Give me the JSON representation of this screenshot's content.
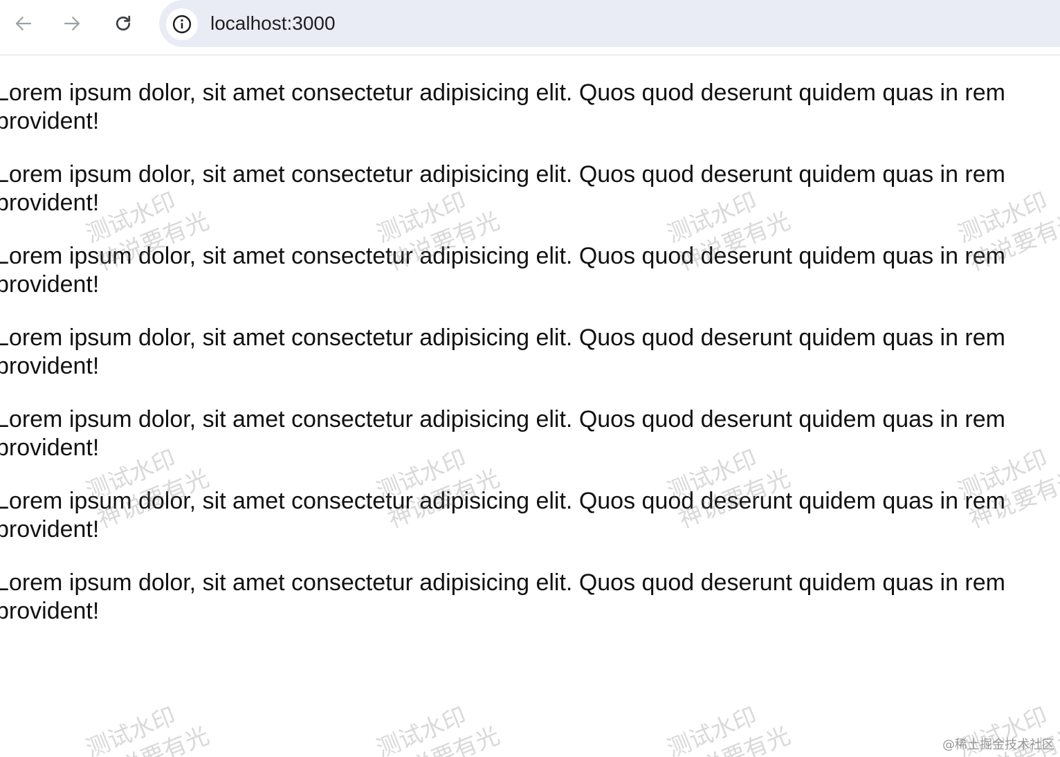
{
  "browser": {
    "url": "localhost:3000",
    "icons": {
      "back": "arrow-left-icon",
      "forward": "arrow-right-icon",
      "reload": "reload-icon",
      "site_info": "info-icon"
    }
  },
  "content": {
    "paragraphs": [
      {
        "line1": "Lorem ipsum dolor, sit amet consectetur adipisicing elit. Quos quod deserunt quidem quas in rem",
        "line2": "provident!"
      },
      {
        "line1": "Lorem ipsum dolor, sit amet consectetur adipisicing elit. Quos quod deserunt quidem quas in rem",
        "line2": "provident!"
      },
      {
        "line1": "Lorem ipsum dolor, sit amet consectetur adipisicing elit. Quos quod deserunt quidem quas in rem",
        "line2": "provident!"
      },
      {
        "line1": "Lorem ipsum dolor, sit amet consectetur adipisicing elit. Quos quod deserunt quidem quas in rem",
        "line2": "provident!"
      },
      {
        "line1": "Lorem ipsum dolor, sit amet consectetur adipisicing elit. Quos quod deserunt quidem quas in rem",
        "line2": "provident!"
      },
      {
        "line1": "Lorem ipsum dolor, sit amet consectetur adipisicing elit. Quos quod deserunt quidem quas in rem",
        "line2": "provident!"
      },
      {
        "line1": "Lorem ipsum dolor, sit amet consectetur adipisicing elit. Quos quod deserunt quidem quas in rem",
        "line2": "provident!"
      }
    ]
  },
  "watermark": {
    "line1": "测试水印",
    "line2": "神说要有光",
    "color": "#787878"
  },
  "credit": "@稀土掘金技术社区"
}
